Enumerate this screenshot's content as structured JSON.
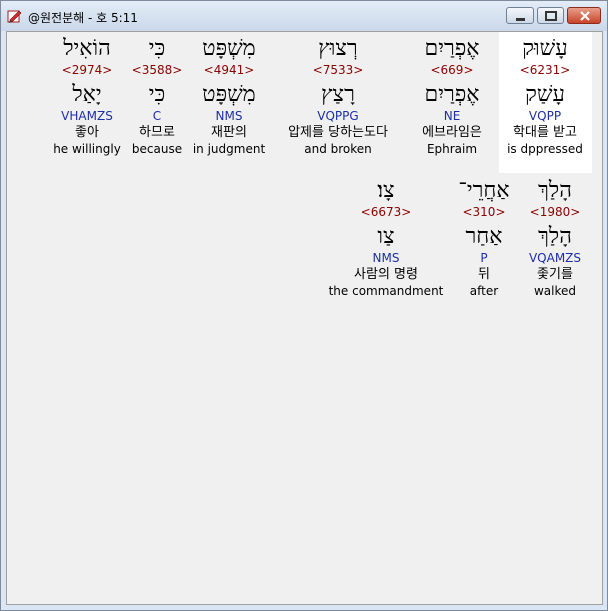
{
  "window": {
    "title": "@원전분해 - 호 5:11",
    "icon": "pen-book-icon"
  },
  "row1": [
    {
      "hebrew": "עָשׁוּק",
      "strong": "<6231>",
      "lemma": "עָשַׁק",
      "morph": "VQPP",
      "korean": "학대를 받고",
      "english": "is dppressed",
      "highlight": true
    },
    {
      "hebrew": "אֶפְרַיִם",
      "strong": "<669>",
      "lemma": "אֶפְרַיִם",
      "morph": "NE",
      "korean": "에브라임은",
      "english": "Ephraim"
    },
    {
      "hebrew": "רְצוּץ",
      "strong": "<7533>",
      "lemma": "רָצַץ",
      "morph": "VQPPG",
      "korean": "압제를 당하는도다",
      "english": "and broken"
    },
    {
      "hebrew": "מִשְׁפָּט",
      "strong": "<4941>",
      "lemma": "מִשְׁפָּט",
      "morph": "NMS",
      "korean": "재판의",
      "english": "in judgment"
    },
    {
      "hebrew": "כִּי",
      "strong": "<3588>",
      "lemma": "כִּי",
      "morph": "C",
      "korean": "하므로",
      "english": "because"
    },
    {
      "hebrew": "הוֹאִיל",
      "strong": "<2974>",
      "lemma": "יָאַל",
      "morph": "VHAMZS",
      "korean": "좋아",
      "english": "he willingly"
    }
  ],
  "row2": [
    {
      "hebrew": "הָלַךְ",
      "strong": "<1980>",
      "lemma": "הָלַךְ",
      "morph": "VQAMZS",
      "korean": "좇기를",
      "english": "walked"
    },
    {
      "hebrew": "אַחֲרֵי־",
      "strong": "<310>",
      "lemma": "אַחַר",
      "morph": "P",
      "korean": "뒤",
      "english": "after"
    },
    {
      "hebrew": "צָו׃",
      "strong": "<6673>",
      "lemma": "צַו",
      "morph": "NMS",
      "korean": "사람의 명령",
      "english": "the commandment"
    }
  ]
}
